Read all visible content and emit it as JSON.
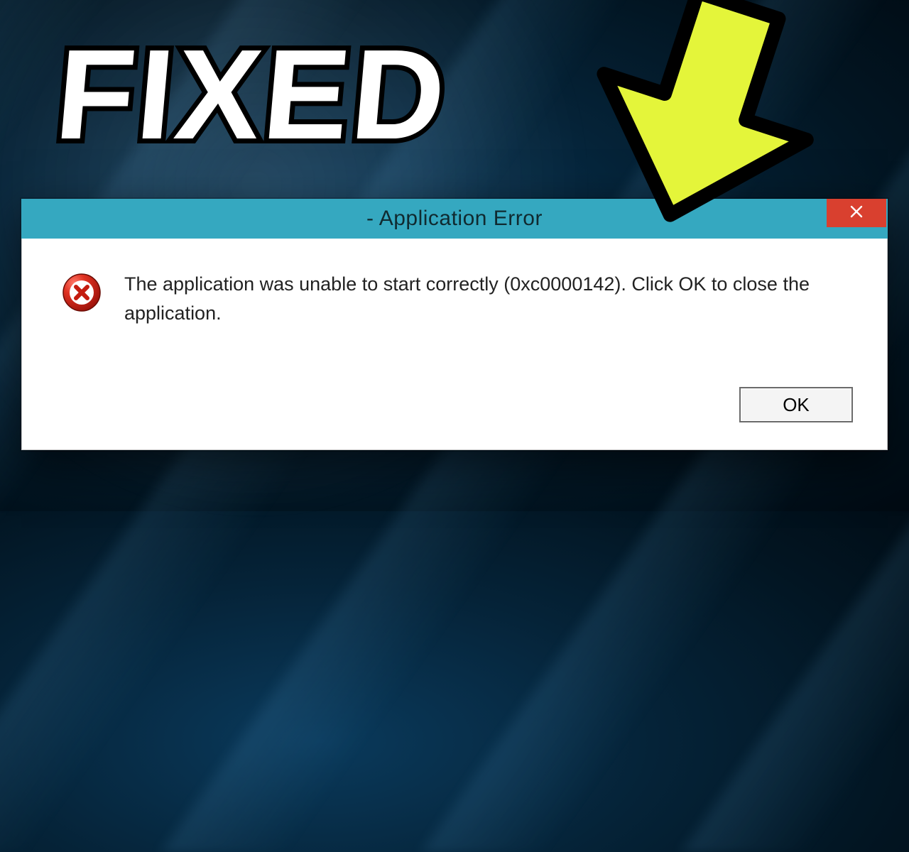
{
  "overlay": {
    "headline": "FIXED"
  },
  "dialog": {
    "title": " - Application Error",
    "message": "The application was unable to start correctly (0xc0000142). Click OK to close the application.",
    "ok_label": "OK"
  },
  "colors": {
    "arrow_fill": "#e4f53a",
    "arrow_stroke": "#000000",
    "close_bg": "#d9402f",
    "titlebar_bg": "#35a8c0"
  }
}
